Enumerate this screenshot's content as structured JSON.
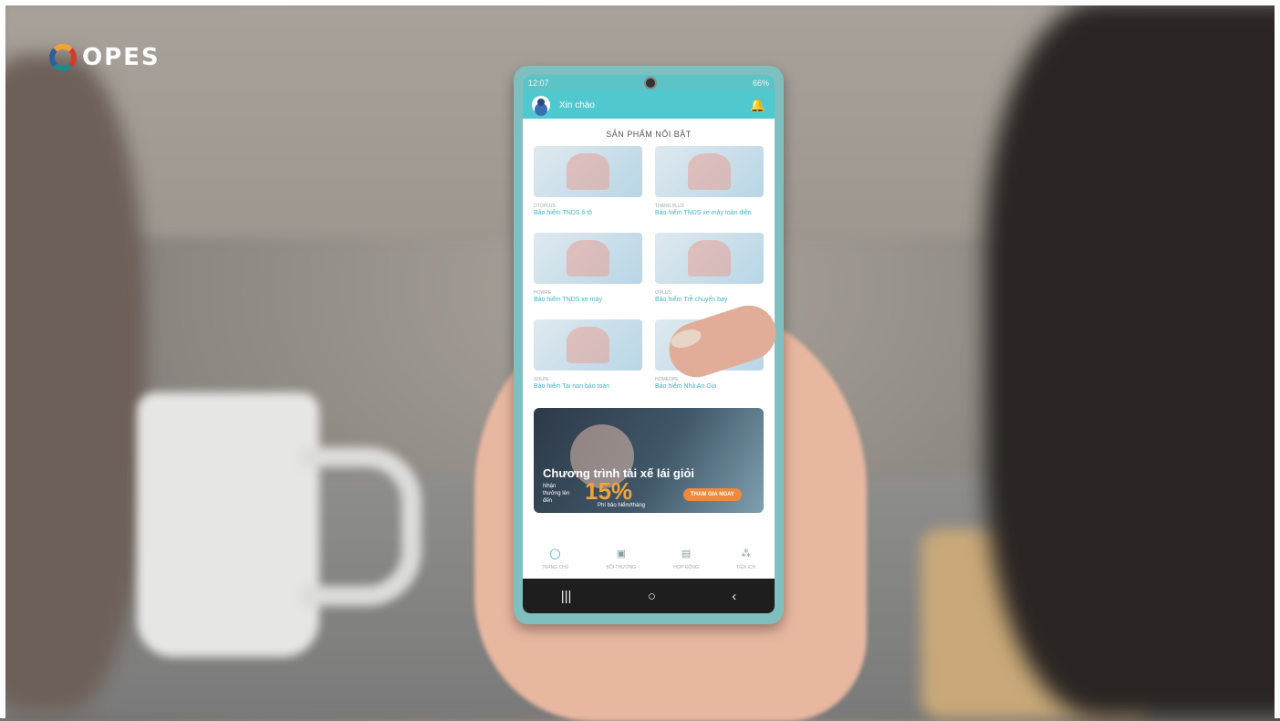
{
  "logo": {
    "text": "OPES"
  },
  "status_bar": {
    "time": "12:07",
    "battery": "66%"
  },
  "app_bar": {
    "greeting": "Xin chào"
  },
  "section_title": "SẢN PHẨM NỔI BẬT",
  "products": [
    {
      "code": "OTOPLUS",
      "name": "Bảo hiểm TNDS ô tô"
    },
    {
      "code": "THANG PLUS",
      "name": "Bảo hiểm TNDS xe máy toàn diện"
    },
    {
      "code": "HOWRE",
      "name": "Bảo hiểm TNDS xe máy"
    },
    {
      "code": "O'PLUS",
      "name": "Bảo hiểm Trễ chuyến bay"
    },
    {
      "code": "SOLPE",
      "name": "Bảo hiểm Tai nạn bảo toàn"
    },
    {
      "code": "HOMEOPE",
      "name": "Bảo hiểm Nhà An Gia"
    }
  ],
  "banner": {
    "title": "Chương trình tài xế lái giỏi",
    "sub": "Nhận thưởng lên đến",
    "percent": "15%",
    "note": "Phí bảo hiểm/tháng",
    "button": "THAM GIA NGAY"
  },
  "tabs": [
    {
      "label": "TRANG CHỦ",
      "icon": "home-ring-icon"
    },
    {
      "label": "BỒI THƯỜNG",
      "icon": "claim-icon"
    },
    {
      "label": "HỢP ĐỒNG",
      "icon": "contract-icon"
    },
    {
      "label": "TIỆN ÍCH",
      "icon": "utility-icon"
    }
  ],
  "nav": {
    "recent": "|||",
    "home": "○",
    "back": "‹"
  },
  "colors": {
    "primary": "#4fc9cf",
    "accent": "#f2a33b",
    "link": "#3db7c6"
  }
}
